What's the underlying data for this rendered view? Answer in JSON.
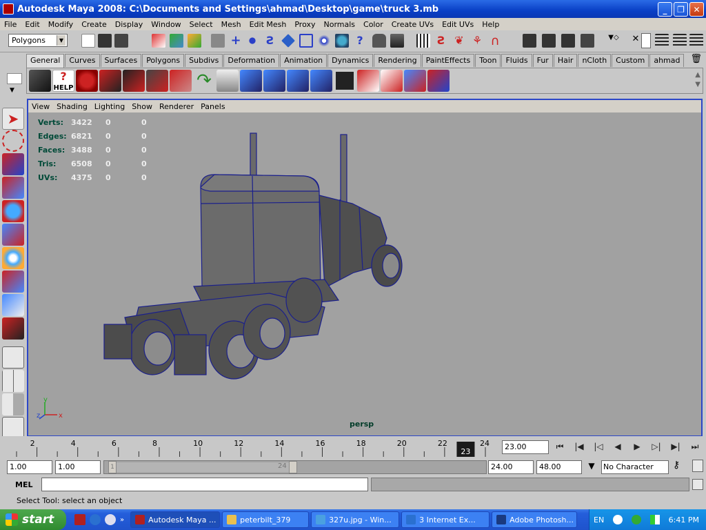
{
  "window": {
    "title": "Autodesk Maya 2008: C:\\Documents and Settings\\ahmad\\Desktop\\game\\truck 3.mb"
  },
  "menubar": [
    "File",
    "Edit",
    "Modify",
    "Create",
    "Display",
    "Window",
    "Select",
    "Mesh",
    "Edit Mesh",
    "Proxy",
    "Normals",
    "Color",
    "Create UVs",
    "Edit UVs",
    "Help"
  ],
  "status_line": {
    "mode": "Polygons"
  },
  "shelf": {
    "tabs": [
      "General",
      "Curves",
      "Surfaces",
      "Polygons",
      "Subdivs",
      "Deformation",
      "Animation",
      "Dynamics",
      "Rendering",
      "PaintEffects",
      "Toon",
      "Fluids",
      "Fur",
      "Hair",
      "nCloth",
      "Custom",
      "ahmad"
    ],
    "active_tab": "General",
    "help_label": "HELP"
  },
  "viewport": {
    "menu": [
      "View",
      "Shading",
      "Lighting",
      "Show",
      "Renderer",
      "Panels"
    ],
    "hud": [
      {
        "label": "Verts:",
        "value": "3422",
        "a": "0",
        "b": "0"
      },
      {
        "label": "Edges:",
        "value": "6821",
        "a": "0",
        "b": "0"
      },
      {
        "label": "Faces:",
        "value": "3488",
        "a": "0",
        "b": "0"
      },
      {
        "label": "Tris:",
        "value": "6508",
        "a": "0",
        "b": "0"
      },
      {
        "label": "UVs:",
        "value": "4375",
        "a": "0",
        "b": "0"
      }
    ],
    "camera": "persp",
    "axis_x": "x",
    "axis_y": "y",
    "axis_z": "z"
  },
  "timeline": {
    "ticks": [
      "2",
      "4",
      "6",
      "8",
      "10",
      "12",
      "14",
      "16",
      "18",
      "20",
      "22",
      "24"
    ],
    "current_frame_marker": "23",
    "current_time": "23.00"
  },
  "range": {
    "start": "1.00",
    "playback_start": "1.00",
    "slider_start": "1",
    "slider_end": "24",
    "playback_end": "24.00",
    "end": "48.00",
    "character_set": "No Character Set"
  },
  "command_line": {
    "label": "MEL"
  },
  "help_line": "Select Tool: select an object",
  "taskbar": {
    "start": "start",
    "items": [
      {
        "label": "Autodesk Maya ...",
        "color": "#b02020",
        "active": true
      },
      {
        "label": "peterbilt_379",
        "color": "#e8c050",
        "active": false
      },
      {
        "label": "327u.jpg - Win...",
        "color": "#4aa0e0",
        "active": false
      },
      {
        "label": "3 Internet Ex...",
        "color": "#2a70d0",
        "active": false
      },
      {
        "label": "Adobe Photosh...",
        "color": "#1a3a80",
        "active": false
      }
    ],
    "lang": "EN",
    "clock": "6:41 PM"
  }
}
